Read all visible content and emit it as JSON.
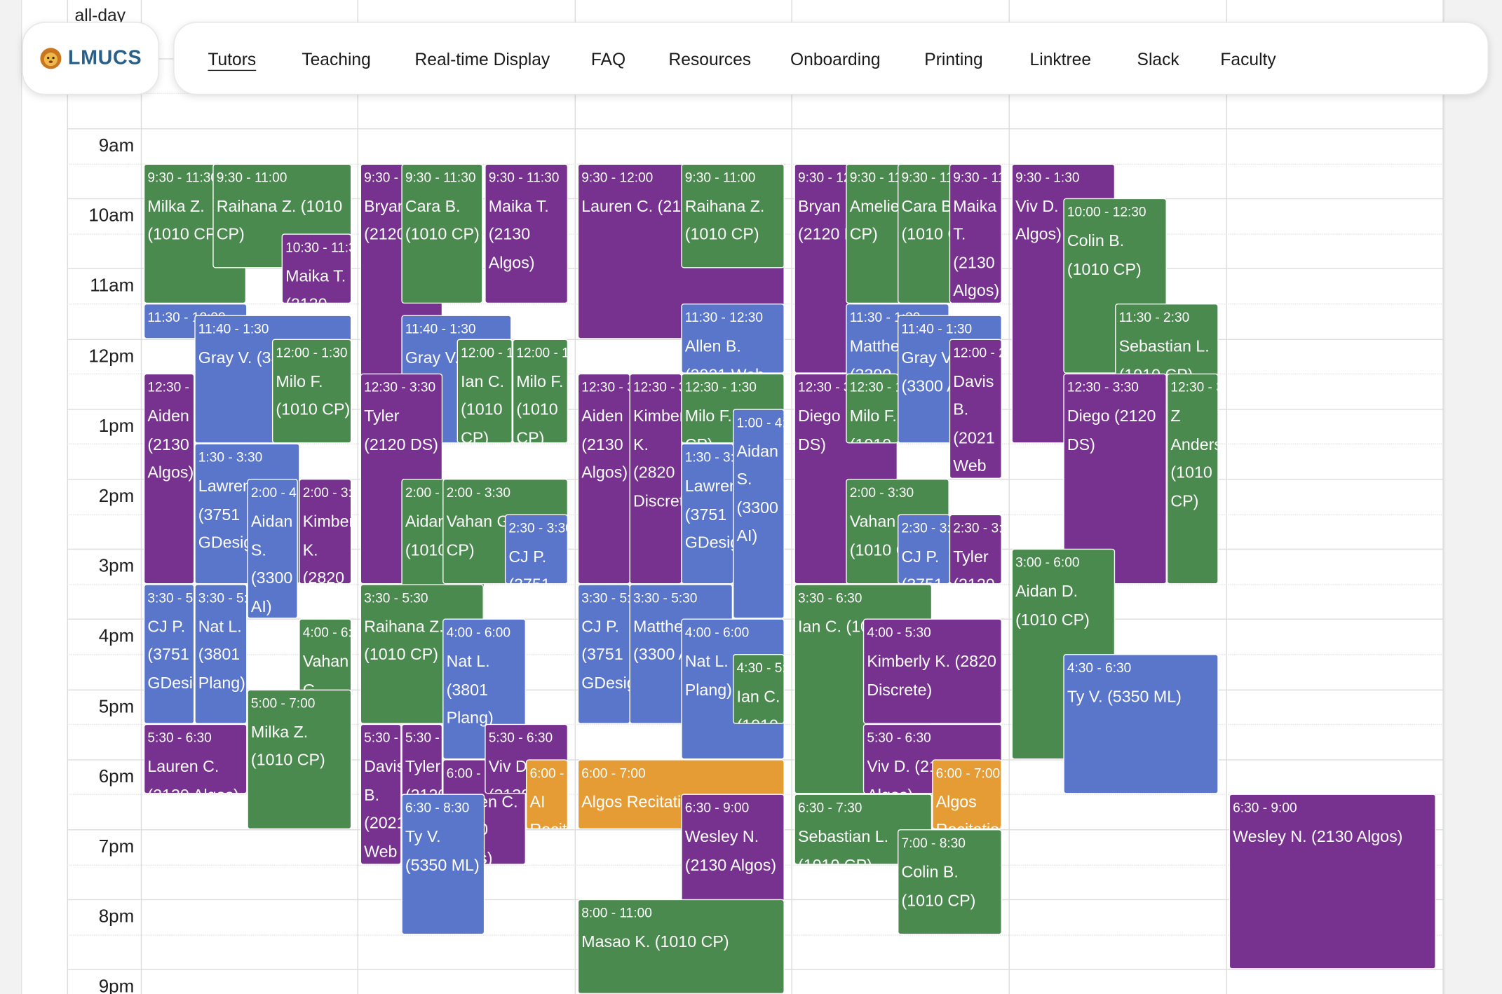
{
  "nav": {
    "logo_text": "LMUCS",
    "items": [
      "Tutors",
      "Teaching",
      "Real-time Display",
      "FAQ",
      "Resources",
      "Onboarding",
      "Printing",
      "Linktree",
      "Slack",
      "Faculty"
    ],
    "active": "Tutors"
  },
  "calendar": {
    "allday_label": "all-day",
    "time_labels": [
      "9am",
      "10am",
      "11am",
      "12pm",
      "1pm",
      "2pm",
      "3pm",
      "4pm",
      "5pm",
      "6pm",
      "7pm",
      "8pm",
      "9pm"
    ],
    "events": [
      {
        "time": "9:30 - 11:30",
        "name": "Milka Z. (1010 CP)",
        "color": "green"
      },
      {
        "time": "9:30 - 11:00",
        "name": "Raihana Z. (1010 CP)",
        "color": "green"
      },
      {
        "time": "10:30 - 11:30",
        "name": "Maika T. (2130 Algos)",
        "color": "purple"
      },
      {
        "time": "11:30 - 12:00",
        "name": "Allen B. (2021 Web App)",
        "color": "blue"
      },
      {
        "time": "11:40 - 1:30",
        "name": "Gray V. (3300 AI)",
        "color": "blue"
      },
      {
        "time": "12:00 - 1:30",
        "name": "Milo F. (1010 CP)",
        "color": "green"
      },
      {
        "time": "12:30 - 3:30",
        "name": "Aiden (2130 Algos)",
        "color": "purple"
      },
      {
        "time": "1:30 - 3:30",
        "name": "Lawrence (3751 GDesign)",
        "color": "blue"
      },
      {
        "time": "2:00 - 4:00",
        "name": "Aidan S. (3300 AI)",
        "color": "blue"
      },
      {
        "time": "2:00 - 3:30",
        "name": "Kimberly K. (2820 Discrete)",
        "color": "purple"
      },
      {
        "time": "3:30 - 5:30",
        "name": "CJ P. (3751 GDesign)",
        "color": "blue"
      },
      {
        "time": "3:30 - 5:30",
        "name": "Nat L. (3801 Plang)",
        "color": "blue"
      },
      {
        "time": "4:00 - 6:00",
        "name": "Vahan G. (1010 CP)",
        "color": "green"
      },
      {
        "time": "5:00 - 7:00",
        "name": "Milka Z. (1010 CP)",
        "color": "green"
      },
      {
        "time": "5:30 - 6:30",
        "name": "Lauren C. (2130 Algos)",
        "color": "purple"
      },
      {
        "time": "9:30 - 1:30",
        "name": "Bryan D. (2120 DS)",
        "color": "purple"
      },
      {
        "time": "9:30 - 11:30",
        "name": "Cara B. (1010 CP)",
        "color": "green"
      },
      {
        "time": "9:30 - 11:30",
        "name": "Maika T. (2130 Algos)",
        "color": "purple"
      },
      {
        "time": "11:40 - 1:30",
        "name": "Gray V. (3300 AI)",
        "color": "blue"
      },
      {
        "time": "12:00 - 1:30",
        "name": "Ian C. (1010 CP)",
        "color": "green"
      },
      {
        "time": "12:00 - 1:30",
        "name": "Milo F. (1010 CP)",
        "color": "green"
      },
      {
        "time": "12:30 - 3:30",
        "name": "Tyler (2120 DS)",
        "color": "purple"
      },
      {
        "time": "2:00 - 5:30",
        "name": "Aidan D. (1010 CP)",
        "color": "green"
      },
      {
        "time": "2:00 - 3:30",
        "name": "Vahan G. (1010 CP)",
        "color": "green"
      },
      {
        "time": "2:30 - 3:30",
        "name": "CJ P. (3751 GDesign)",
        "color": "blue"
      },
      {
        "time": "3:30 - 5:30",
        "name": "Raihana Z. (1010 CP)",
        "color": "green"
      },
      {
        "time": "4:00 - 6:00",
        "name": "Nat L. (3801 Plang)",
        "color": "blue"
      },
      {
        "time": "5:30 - 7:30",
        "name": "Davis B. (2021 Web App)",
        "color": "purple"
      },
      {
        "time": "5:30 - 7:00",
        "name": "Tyler (2120 DS)",
        "color": "purple"
      },
      {
        "time": "6:00 - 7:30",
        "name": "Lauren C. (2130 Algos)",
        "color": "purple"
      },
      {
        "time": "5:30 - 6:30",
        "name": "Viv D. (2130 Algos)",
        "color": "purple"
      },
      {
        "time": "6:00 - 7:00",
        "name": "AI Recitation",
        "color": "orange"
      },
      {
        "time": "6:30 - 8:30",
        "name": "Ty V. (5350 ML)",
        "color": "blue"
      },
      {
        "time": "9:30 - 12:00",
        "name": "Lauren C. (2130 Algos)",
        "color": "purple"
      },
      {
        "time": "9:30 - 11:00",
        "name": "Raihana Z. (1010 CP)",
        "color": "green"
      },
      {
        "time": "11:30 - 12:30",
        "name": "Allen B. (2021 Web App)",
        "color": "blue"
      },
      {
        "time": "12:30 - 3:30",
        "name": "Aiden (2130 Algos)",
        "color": "purple"
      },
      {
        "time": "12:30 - 3:30",
        "name": "Kimberly K. (2820 Discrete)",
        "color": "purple"
      },
      {
        "time": "12:30 - 1:30",
        "name": "Milo F. (1010 CP)",
        "color": "green"
      },
      {
        "time": "1:00 - 4:00",
        "name": "Aidan S. (3300 AI)",
        "color": "blue"
      },
      {
        "time": "1:30 - 3:30",
        "name": "Lawrence (3751 GDesign)",
        "color": "blue"
      },
      {
        "time": "3:30 - 5:30",
        "name": "CJ P. (3751 GDesign)",
        "color": "blue"
      },
      {
        "time": "3:30 - 5:30",
        "name": "Matthew (3300 AI)",
        "color": "blue"
      },
      {
        "time": "4:00 - 6:00",
        "name": "Nat L. (3801 Plang)",
        "color": "blue"
      },
      {
        "time": "4:30 - 5:30",
        "name": "Ian C. (1010 CP)",
        "color": "green"
      },
      {
        "time": "6:00 - 7:00",
        "name": "Algos Recitation (Hybrid)",
        "color": "orange"
      },
      {
        "time": "6:30 - 9:00",
        "name": "Wesley N. (2130 Algos)",
        "color": "purple"
      },
      {
        "time": "8:00 - 11:00",
        "name": "Masao K. (1010 CP)",
        "color": "green"
      },
      {
        "time": "9:30 - 12:30",
        "name": "Bryan D. (2120 DS)",
        "color": "purple"
      },
      {
        "time": "9:30 - 11:30",
        "name": "Amelie (1010 CP)",
        "color": "green"
      },
      {
        "time": "9:30 - 11:30",
        "name": "Cara B. (1010 CP)",
        "color": "green"
      },
      {
        "time": "9:30 - 11:30",
        "name": "Maika T. (2130 Algos)",
        "color": "purple"
      },
      {
        "time": "11:30 - 1:30",
        "name": "Matthew (3300 AI)",
        "color": "blue"
      },
      {
        "time": "11:40 - 1:30",
        "name": "Gray V. (3300 AI)",
        "color": "blue"
      },
      {
        "time": "12:00 - 2:00",
        "name": "Davis B. (2021 Web App)",
        "color": "purple"
      },
      {
        "time": "12:30 - 3:30",
        "name": "Diego (2120 DS)",
        "color": "purple"
      },
      {
        "time": "12:30 - 1:30",
        "name": "Milo F. (1010 CP)",
        "color": "green"
      },
      {
        "time": "2:00 - 3:30",
        "name": "Vahan G. (1010 CP)",
        "color": "green"
      },
      {
        "time": "2:30 - 3:30",
        "name": "CJ P. (3751 GDesign)",
        "color": "blue"
      },
      {
        "time": "2:30 - 3:30",
        "name": "Tyler (2120 DS)",
        "color": "purple"
      },
      {
        "time": "3:30 - 6:30",
        "name": "Ian C. (1010 CP)",
        "color": "green"
      },
      {
        "time": "4:00 - 5:30",
        "name": "Kimberly K. (2820 Discrete)",
        "color": "purple"
      },
      {
        "time": "5:30 - 6:30",
        "name": "Viv D. (2130 Algos)",
        "color": "purple"
      },
      {
        "time": "6:00 - 7:00",
        "name": "Algos Recitation",
        "color": "orange"
      },
      {
        "time": "6:30 - 7:30",
        "name": "Sebastian L. (1010 CP)",
        "color": "green"
      },
      {
        "time": "7:00 - 8:30",
        "name": "Colin B. (1010 CP)",
        "color": "green"
      },
      {
        "time": "9:30 - 1:30",
        "name": "Viv D. (2130 Algos)",
        "color": "purple"
      },
      {
        "time": "10:00 - 12:30",
        "name": "Colin B. (1010 CP)",
        "color": "green"
      },
      {
        "time": "11:30 - 2:30",
        "name": "Sebastian L. (1010 CP)",
        "color": "green"
      },
      {
        "time": "12:30 - 3:30",
        "name": "Diego (2120 DS)",
        "color": "purple"
      },
      {
        "time": "12:30 - 3:30",
        "name": "Z Anderson (1010 CP)",
        "color": "green"
      },
      {
        "time": "3:00 - 6:00",
        "name": "Aidan D. (1010 CP)",
        "color": "green"
      },
      {
        "time": "4:30 - 6:30",
        "name": "Ty V. (5350 ML)",
        "color": "blue"
      },
      {
        "time": "6:30 - 9:00",
        "name": "Wesley N. (2130 Algos)",
        "color": "purple"
      }
    ]
  },
  "colors": {
    "green": "#4b8a4e",
    "purple": "#77318f",
    "blue": "#5976cb",
    "orange": "#e59c35",
    "accent": "#2a5f87"
  }
}
